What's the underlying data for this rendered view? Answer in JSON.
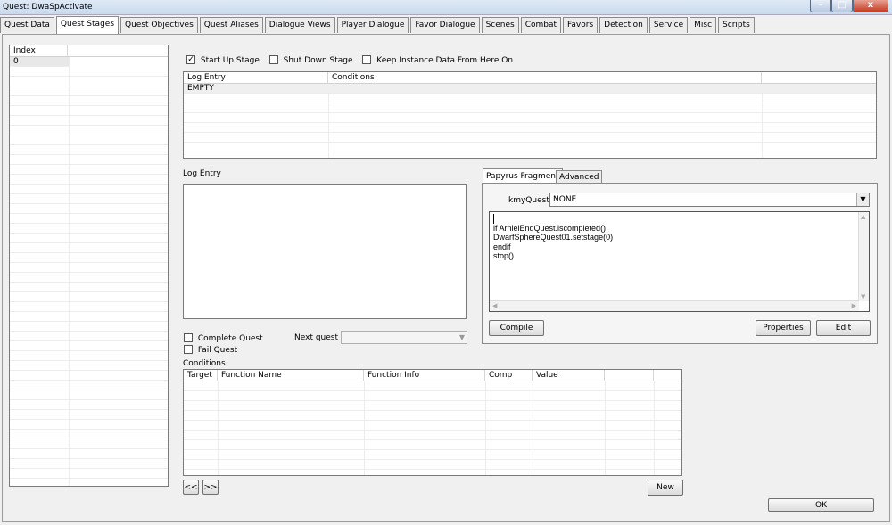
{
  "window": {
    "title": "Quest: DwaSpActivate",
    "min_label": "–",
    "max_label": "□",
    "close_label": "x"
  },
  "tabs": [
    "Quest Data",
    "Quest Stages",
    "Quest Objectives",
    "Quest Aliases",
    "Dialogue Views",
    "Player Dialogue",
    "Favor Dialogue",
    "Scenes",
    "Combat",
    "Favors",
    "Detection",
    "Service",
    "Misc",
    "Scripts"
  ],
  "active_tab": "Quest Stages",
  "index_list": {
    "header": "Index",
    "rows": [
      "0"
    ]
  },
  "stage_flags": {
    "start_up": "Start Up Stage",
    "shut_down": "Shut Down Stage",
    "keep_instance": "Keep Instance Data From Here On",
    "check_mark": "✓"
  },
  "log_table": {
    "headers": [
      "Log Entry",
      "Conditions"
    ],
    "rows": [
      [
        "EMPTY",
        ""
      ]
    ]
  },
  "log_entry": {
    "label": "Log Entry",
    "text": ""
  },
  "complete_quest": "Complete Quest",
  "fail_quest": "Fail Quest",
  "next_quest": {
    "label": "Next quest",
    "value": ""
  },
  "fragment_tabs": [
    "Papyrus Fragment",
    "Advanced"
  ],
  "kmy_quest": {
    "label": "kmyQuest",
    "value": "NONE"
  },
  "code_lines": [
    "",
    "if ArnielEndQuest.iscompleted()",
    "DwarfSphereQuest01.setstage(0)",
    "endif",
    "stop()"
  ],
  "buttons": {
    "compile": "Compile",
    "properties": "Properties",
    "edit": "Edit",
    "prev": "<<",
    "next": ">>",
    "new": "New",
    "ok": "OK"
  },
  "conditions": {
    "label": "Conditions",
    "headers": [
      "Target",
      "Function Name",
      "Function Info",
      "Comp",
      "Value",
      ""
    ]
  }
}
